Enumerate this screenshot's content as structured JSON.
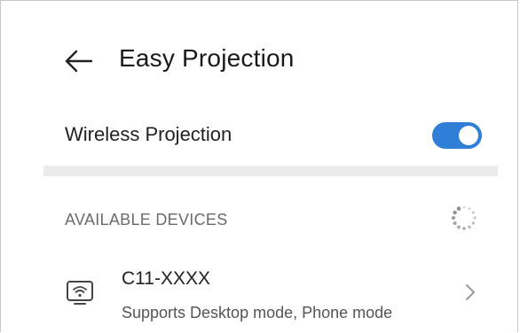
{
  "colors": {
    "accent": "#2f7fd6",
    "icon": "#444444",
    "spinner": "#8a8a8a",
    "chevron": "#9a9a9a"
  },
  "header": {
    "back_icon": "arrow-left-icon",
    "title": "Easy Projection"
  },
  "wireless_projection": {
    "label": "Wireless Projection",
    "enabled": true
  },
  "available_devices": {
    "section_title": "AVAILABLE DEVICES",
    "loading_icon": "spinner-icon",
    "devices": [
      {
        "name": "C11-XXXX",
        "description": "Supports Desktop mode, Phone mode",
        "icon": "wireless-display-icon",
        "trailing_icon": "chevron-right-icon"
      }
    ]
  }
}
